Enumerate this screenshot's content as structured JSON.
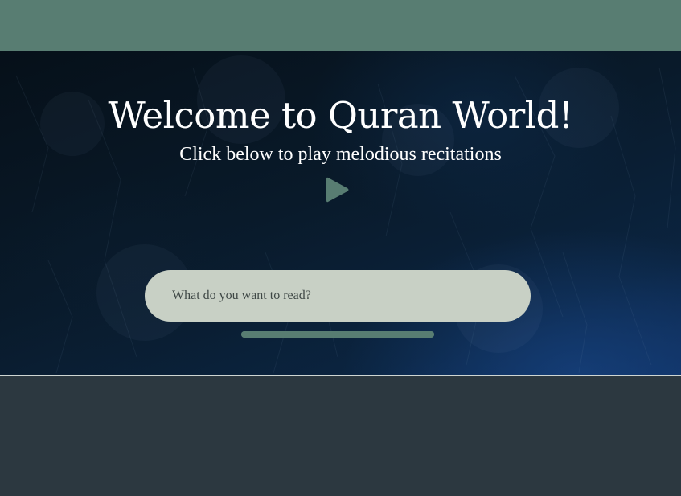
{
  "colors": {
    "top_bar": "#587d72",
    "accent": "#587d72",
    "search_background": "#c8d0c5",
    "page_background": "#2c3840",
    "text_light": "#ffffff"
  },
  "hero": {
    "title": "Welcome to Quran World!",
    "subtitle": "Click below to play melodious recitations",
    "play_icon": "play-icon"
  },
  "search": {
    "placeholder": "What do you want to read?",
    "value": ""
  },
  "progress": {
    "fraction": 1.0
  }
}
